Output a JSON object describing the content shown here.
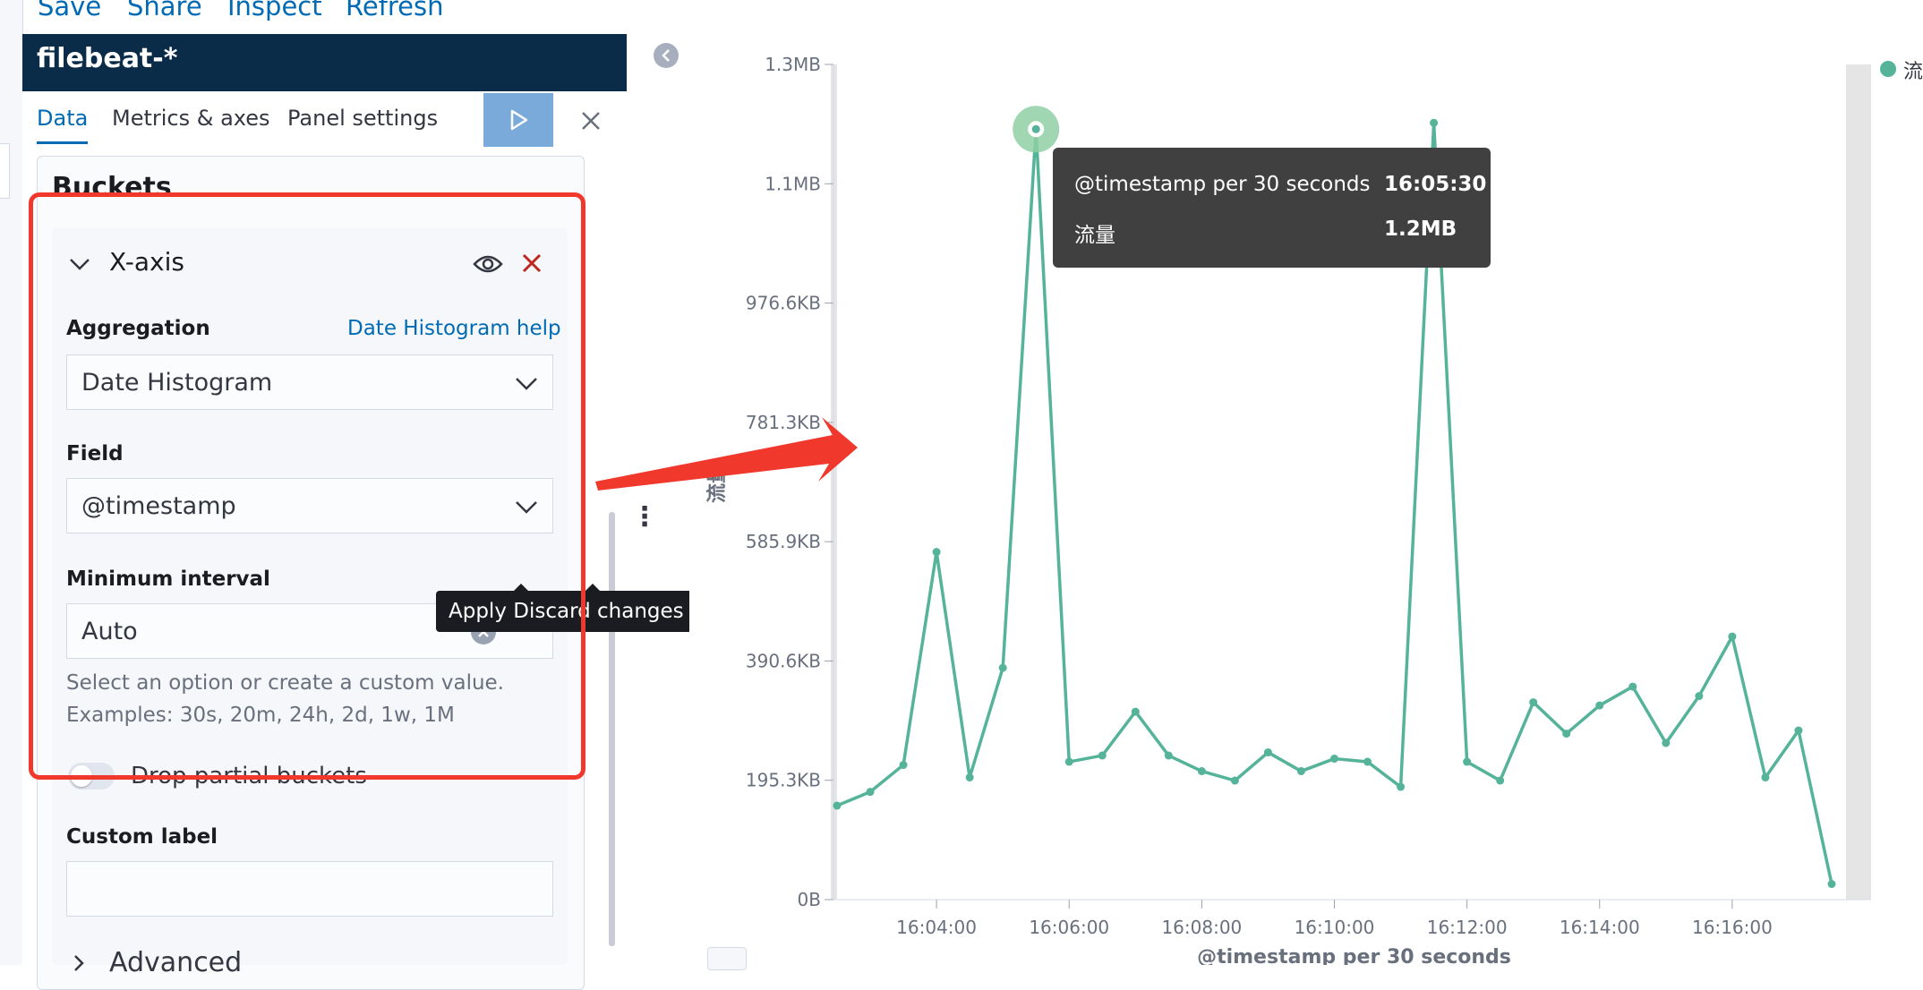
{
  "toolbar": {
    "save": "Save",
    "share": "Share",
    "inspect": "Inspect",
    "refresh": "Refresh"
  },
  "editor": {
    "index_pattern": "filebeat-*",
    "tabs": [
      "Data",
      "Metrics & axes",
      "Panel settings"
    ],
    "active_tab": "Data",
    "buckets_title": "Buckets",
    "xaxis": {
      "title": "X-axis",
      "aggregation_label": "Aggregation",
      "aggregation_help": "Date Histogram help",
      "aggregation_value": "Date Histogram",
      "field_label": "Field",
      "field_value": "@timestamp",
      "interval_label": "Minimum interval",
      "interval_value": "Auto",
      "interval_help_line1": "Select an option or create a custom value.",
      "interval_help_line2": "Examples: 30s, 20m, 24h, 2d, 1w, 1M",
      "drop_partial_label": "Drop partial buckets",
      "custom_label": "Custom label",
      "custom_label_value": "",
      "advanced": "Advanced"
    },
    "tooltip_text": "Apply Discard changes"
  },
  "chart_data": {
    "type": "line",
    "xlabel": "@timestamp per 30 seconds",
    "ylabel": "流量",
    "y_ticks": [
      "0B",
      "195.3KB",
      "390.6KB",
      "585.9KB",
      "781.3KB",
      "976.6KB",
      "1.1MB",
      "1.3MB"
    ],
    "x_ticks": [
      "16:04:00",
      "16:06:00",
      "16:08:00",
      "16:10:00",
      "16:12:00",
      "16:14:00",
      "16:16:00"
    ],
    "series": [
      {
        "name": "流量",
        "color": "#54b399",
        "x": [
          "16:02:30",
          "16:03:00",
          "16:03:30",
          "16:04:00",
          "16:04:30",
          "16:05:00",
          "16:05:30",
          "16:06:00",
          "16:06:30",
          "16:07:00",
          "16:07:30",
          "16:08:00",
          "16:08:30",
          "16:09:00",
          "16:09:30",
          "16:10:00",
          "16:10:30",
          "16:11:00",
          "16:11:30",
          "16:12:00",
          "16:12:30",
          "16:13:00",
          "16:13:30",
          "16:14:00",
          "16:14:30",
          "16:15:00",
          "16:15:30",
          "16:16:00",
          "16:16:30",
          "16:17:00",
          "16:17:30"
        ],
        "values": [
          150,
          172,
          215,
          555,
          195,
          370,
          1230,
          220,
          230,
          300,
          230,
          205,
          190,
          235,
          205,
          225,
          220,
          180,
          1240,
          220,
          190,
          315,
          265,
          310,
          340,
          250,
          325,
          420,
          195,
          270,
          25
        ]
      }
    ],
    "ymax_kb": 1333.33,
    "highlighted_point": {
      "x": "16:05:30",
      "value": "1.2MB"
    },
    "legend": "top-right"
  },
  "chart_tooltip": {
    "row1_key": "@timestamp per 30 seconds",
    "row1_value": "16:05:30",
    "row2_key": "流量",
    "row2_value": "1.2MB"
  },
  "legend": {
    "label": "流"
  }
}
